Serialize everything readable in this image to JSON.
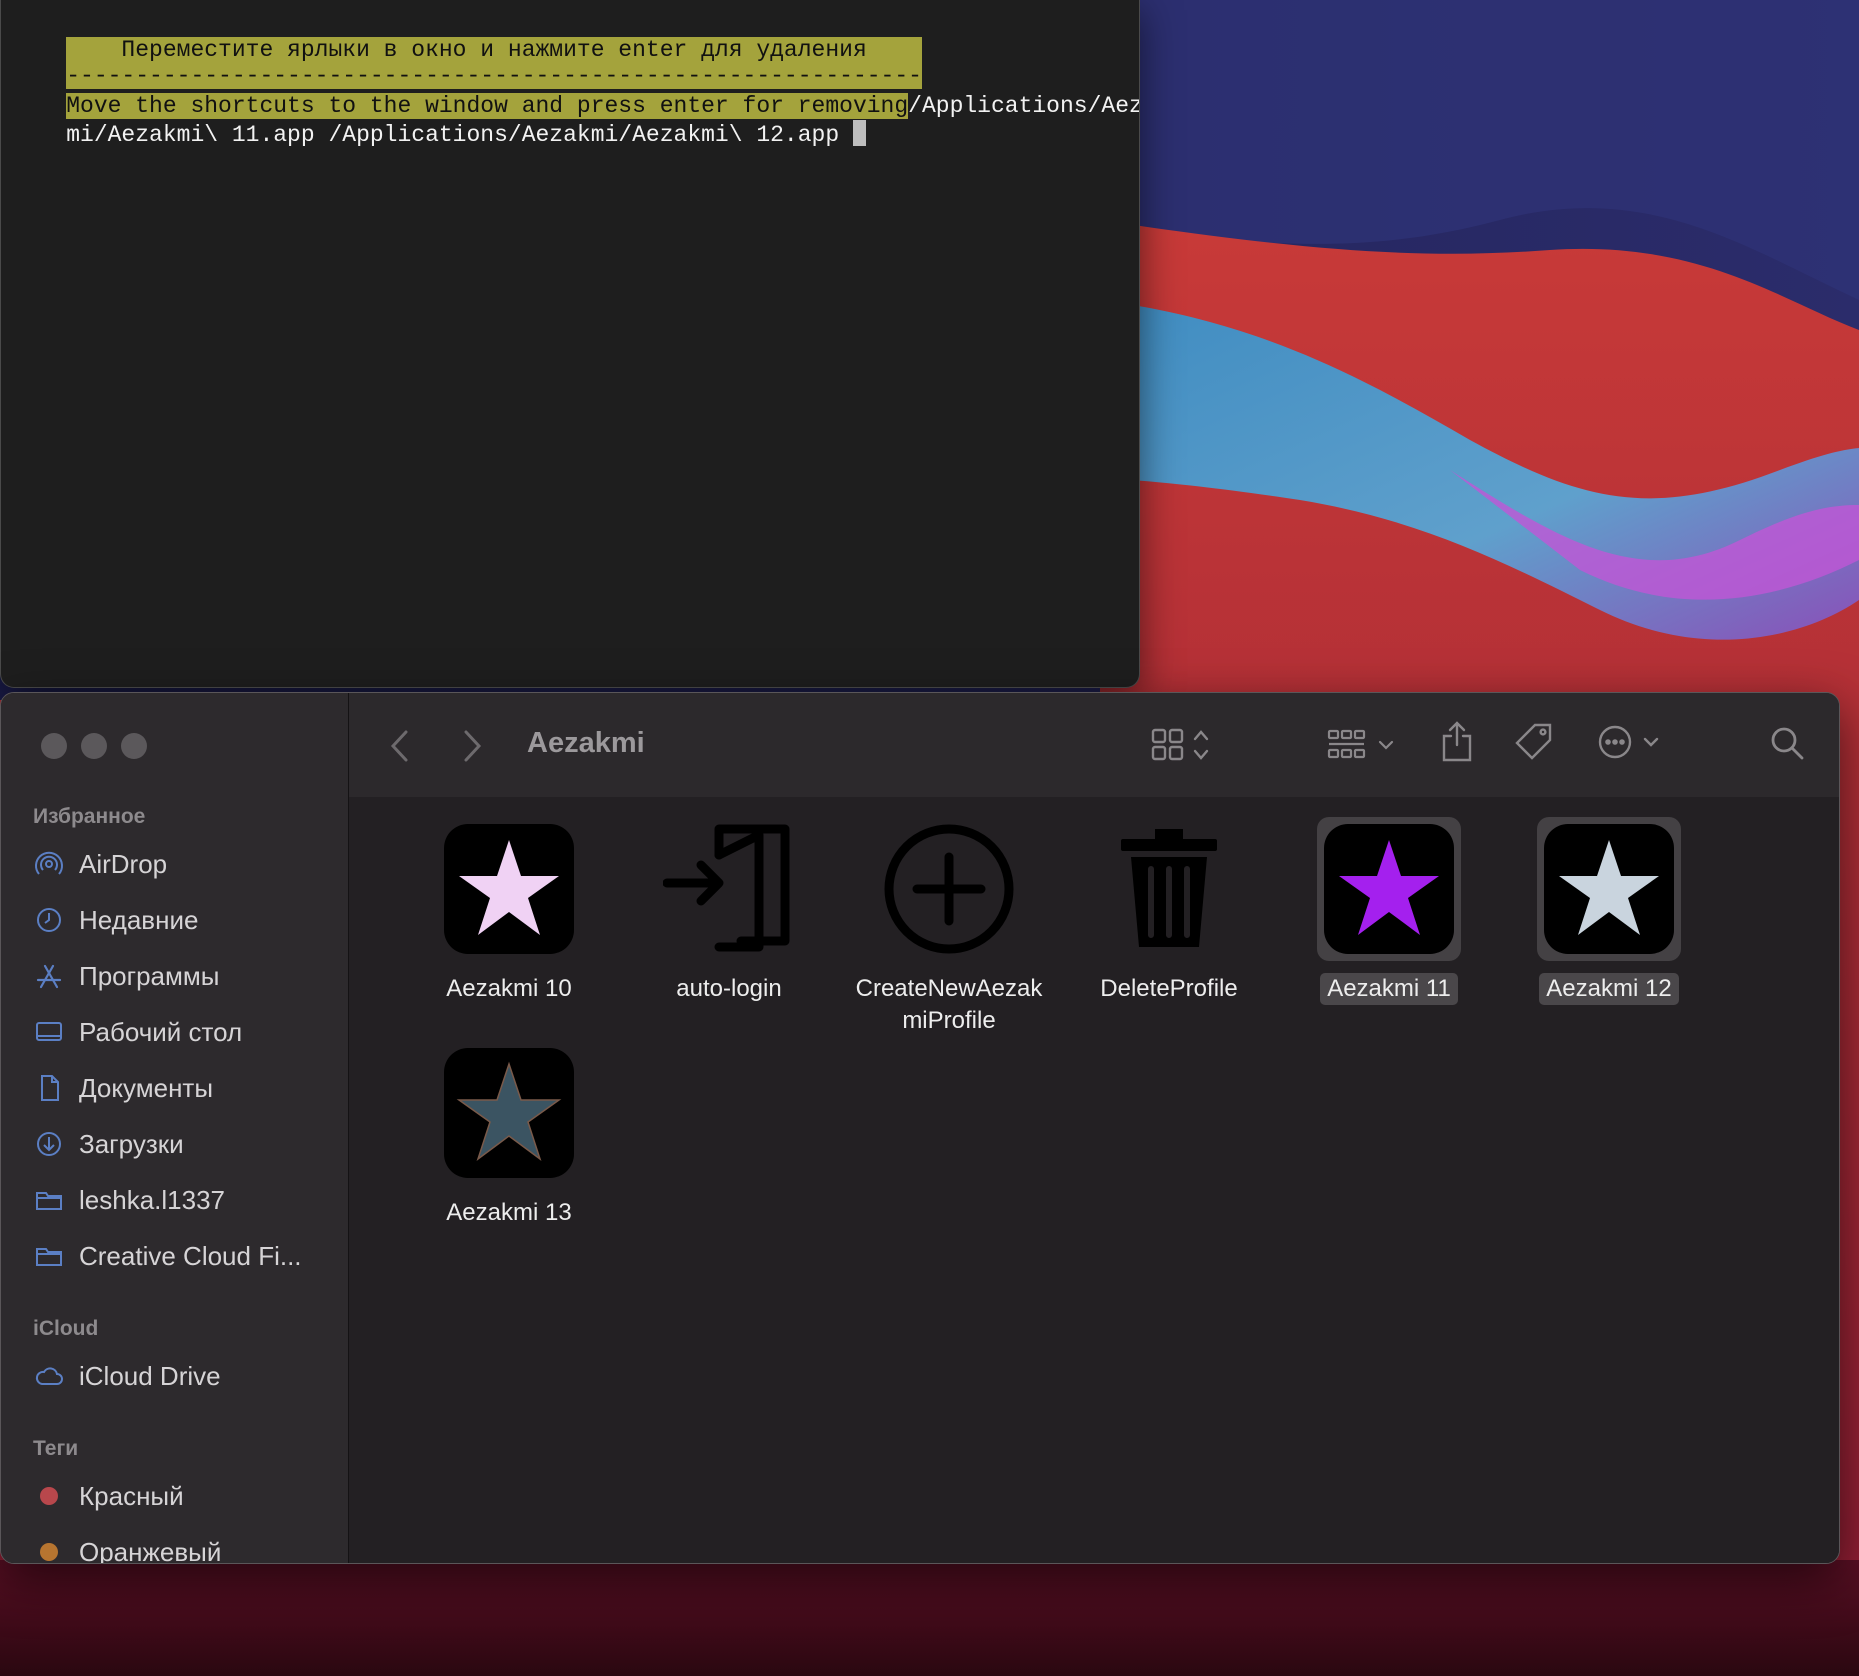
{
  "terminal": {
    "header_ru": "    Переместите ярлыки в окно и нажмите enter для удаления    ",
    "separator": "--------------------------------------------------------------",
    "prompt_en": "Move the shortcuts to the window and press enter for removing",
    "input_line1": "/Applications/Aezak",
    "input_line2": "mi/Aezakmi\\ 11.app /Applications/Aezakmi/Aezakmi\\ 12.app "
  },
  "finder": {
    "title": "Aezakmi",
    "sidebar": {
      "favorites_heading": "Избранное",
      "favorites": [
        {
          "label": "AirDrop",
          "icon": "airdrop-icon"
        },
        {
          "label": "Недавние",
          "icon": "clock-icon"
        },
        {
          "label": "Программы",
          "icon": "applications-icon"
        },
        {
          "label": "Рабочий стол",
          "icon": "desktop-icon"
        },
        {
          "label": "Документы",
          "icon": "document-icon"
        },
        {
          "label": "Загрузки",
          "icon": "download-icon"
        },
        {
          "label": "leshka.l1337",
          "icon": "folder-icon"
        },
        {
          "label": "Creative Cloud Fi...",
          "icon": "folder-icon"
        }
      ],
      "icloud_heading": "iCloud",
      "icloud": [
        {
          "label": "iCloud Drive",
          "icon": "cloud-icon"
        }
      ],
      "tags_heading": "Теги",
      "tags": [
        {
          "label": "Красный",
          "color": "#b8474c"
        },
        {
          "label": "Оранжевый",
          "color": "#b77530"
        }
      ]
    },
    "files": [
      {
        "label": "Aezakmi 10",
        "icon": "star-app-icon",
        "star_color": "#f0d2f4",
        "selected": false
      },
      {
        "label": "auto-login",
        "icon": "login-door-icon",
        "selected": false
      },
      {
        "label_line1": "CreateNewAezak",
        "label_line2": "miProfile",
        "icon": "plus-circle-icon",
        "selected": false
      },
      {
        "label": "DeleteProfile",
        "icon": "trash-icon",
        "selected": false
      },
      {
        "label": "Aezakmi 11",
        "icon": "star-app-icon",
        "star_color": "#a420ee",
        "selected": true
      },
      {
        "label": "Aezakmi 12",
        "icon": "star-app-icon",
        "star_color": "#c9d4de",
        "selected": true
      },
      {
        "label": "Aezakmi 13",
        "icon": "star-app-icon",
        "star_color": "#3b5462",
        "selected": false
      }
    ]
  },
  "colors": {
    "terminal_highlight": "#a4a33c",
    "terminal_bg": "#1e1e1e",
    "finder_bg": "#232023",
    "sidebar_bg": "#2d2a2d"
  }
}
